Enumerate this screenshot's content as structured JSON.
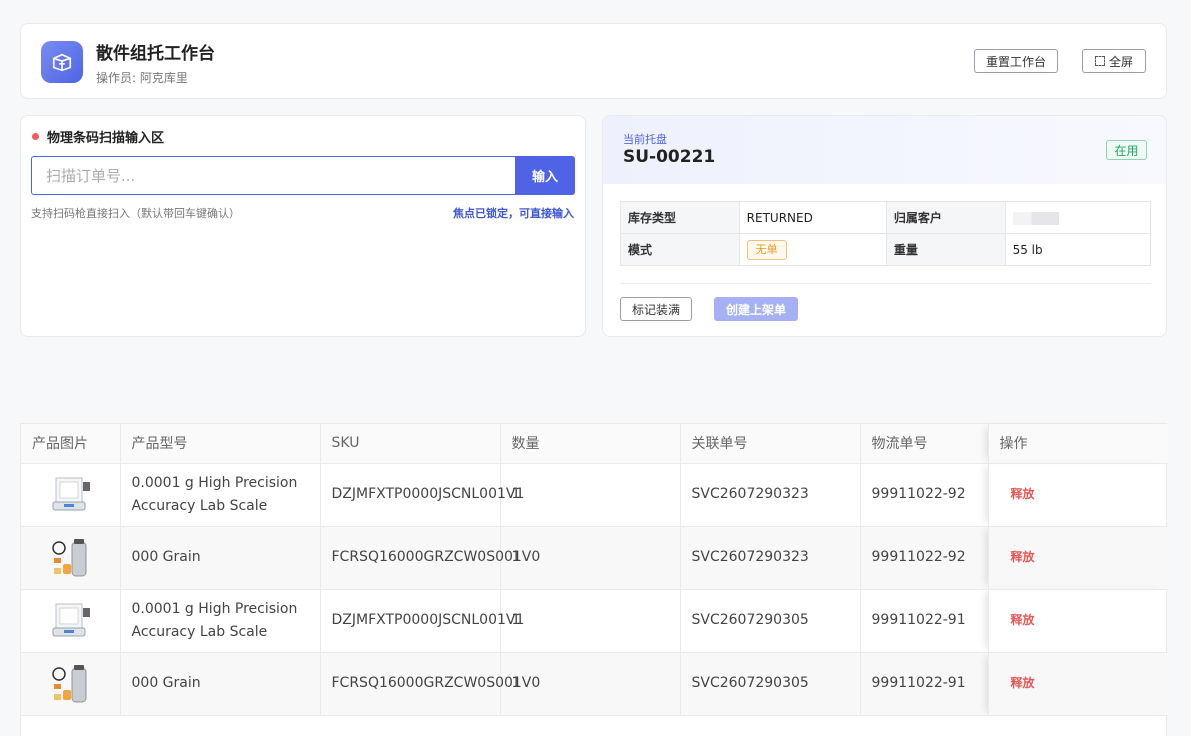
{
  "header": {
    "title": "散件组托工作台",
    "operator": "操作员: 阿克库里",
    "reset_label": "重置工作台",
    "fullscreen_label": "全屏"
  },
  "scan": {
    "title": "物理条码扫描输入区",
    "placeholder": "扫描订单号...",
    "submit_label": "输入",
    "hint": "支持扫码枪直接扫入（默认带回车键确认）",
    "focus_hint": "焦点已锁定，可直接输入"
  },
  "pallet": {
    "subtitle": "当前托盘",
    "code": "SU-00221",
    "status": "在用",
    "inventory_type_label": "库存类型",
    "inventory_type_value": "RETURNED",
    "customer_label": "归属客户",
    "mode_label": "模式",
    "mode_value": "无单",
    "weight_label": "重量",
    "weight_value": "55 lb",
    "mark_full_label": "标记装满",
    "create_label": "创建上架单"
  },
  "table": {
    "headers": [
      "产品图片",
      "产品型号",
      "SKU",
      "数量",
      "关联单号",
      "物流单号",
      "操作"
    ],
    "rows": [
      {
        "model": "0.0001 g High Precision Accuracy Lab Scale",
        "sku": "DZJMFXTP0000JSCNL001V1",
        "qty": "1",
        "ref": "SVC2607290323",
        "tracking": "99911022-92",
        "action": "释放"
      },
      {
        "model": "000 Grain",
        "sku": "FCRSQ16000GRZCW0S001V0",
        "qty": "1",
        "ref": "SVC2607290323",
        "tracking": "99911022-92",
        "action": "释放"
      },
      {
        "model": "0.0001 g High Precision Accuracy Lab Scale",
        "sku": "DZJMFXTP0000JSCNL001V1",
        "qty": "1",
        "ref": "SVC2607290305",
        "tracking": "99911022-91",
        "action": "释放"
      },
      {
        "model": "000 Grain",
        "sku": "FCRSQ16000GRZCW0S001V0",
        "qty": "1",
        "ref": "SVC2607290305",
        "tracking": "99911022-91",
        "action": "释放"
      }
    ]
  },
  "icons": {
    "logo": "box-icon",
    "fullscreen": "expand-icon",
    "product_scale": "lab-scale-image",
    "product_grain": "grain-kit-image"
  },
  "colors": {
    "primary": "#4e63e6",
    "danger": "#e65757",
    "success": "#1fa56b",
    "warning": "#e69a1e"
  }
}
